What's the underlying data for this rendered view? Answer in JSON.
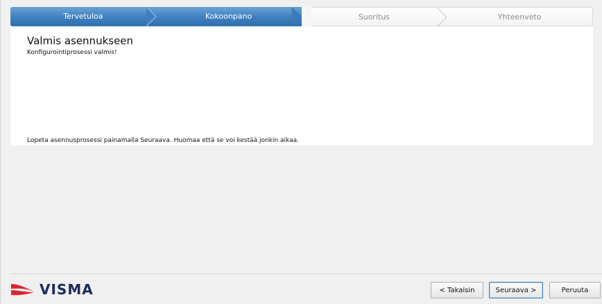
{
  "steps": [
    {
      "label": "Tervetuloa",
      "state": "done"
    },
    {
      "label": "Kokoonpano",
      "state": "current"
    },
    {
      "label": "Suoritus",
      "state": "todo"
    },
    {
      "label": "Yhteenveto",
      "state": "todo"
    }
  ],
  "content": {
    "title": "Valmis asennukseen",
    "subtitle": "Konfigurointiprosessi valmis!",
    "instruction": "Lopeta asennusprosessi painamalla Seuraava. Huomaa että se voi kestää jonkin aikaa."
  },
  "footer": {
    "logo_text": "VISMA",
    "back_label": "< Takaisin",
    "next_label": "Seuraava >",
    "cancel_label": "Peruuta"
  },
  "colors": {
    "step_active": "#3f7fbf",
    "brand_red": "#d9262e",
    "brand_navy": "#1d2a5c"
  }
}
